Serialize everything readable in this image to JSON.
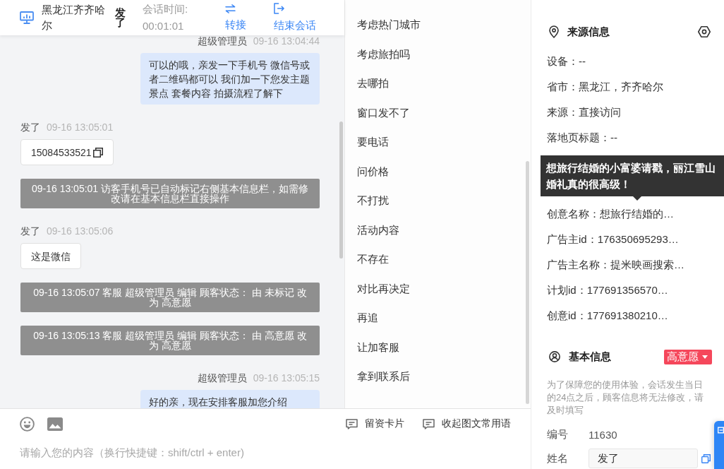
{
  "header": {
    "location": "黑龙江齐齐哈尔",
    "visitor": "发了",
    "duration_label": "会话时间:",
    "duration": "00:01:01",
    "actions": [
      {
        "kind": "transfer",
        "label": "转接"
      },
      {
        "kind": "end",
        "label": "结束会话"
      }
    ]
  },
  "messages": [
    {
      "kind": "agent",
      "sender": "超级管理员",
      "time": "09-16 13:04:44",
      "text": "可以的哦，亲发一下手机号 微信号或者二维码都可以 我们加一下您发主题景点 套餐内容 拍摄流程了解下",
      "copyable": false
    },
    {
      "kind": "visitor",
      "sender": "发了",
      "time": "09-16 13:05:01",
      "text": "15084533521",
      "copyable": true
    },
    {
      "kind": "system",
      "text": "09-16 13:05:01 访客手机号已自动标记右侧基本信息栏，如需修改请在基本信息栏直接操作"
    },
    {
      "kind": "visitor",
      "sender": "发了",
      "time": "09-16 13:05:06",
      "text": "这是微信",
      "copyable": false
    },
    {
      "kind": "system",
      "text": "09-16 13:05:07 客服 超级管理员 编辑 顾客状态： 由 未标记 改为 高意愿"
    },
    {
      "kind": "system",
      "text": "09-16 13:05:13 客服 超级管理员 编辑 顾客状态： 由 高意愿 改为 高意愿"
    },
    {
      "kind": "agent",
      "sender": "超级管理员",
      "time": "09-16 13:05:15",
      "text": "好的亲，现在安排客服加您介绍",
      "copyable": false
    }
  ],
  "quick_replies": [
    "考虑热门城市",
    "考虑旅拍吗",
    "去哪拍",
    "窗口发不了",
    "要电话",
    "问价格",
    "不打扰",
    "活动内容",
    "不存在",
    "对比再决定",
    "再追",
    "让加客服",
    "拿到联系后"
  ],
  "composer": {
    "shortcuts": [
      "留资卡片",
      "收起图文常用语"
    ],
    "placeholder": "请输入您的内容（换行快捷键：shift/ctrl + enter)"
  },
  "source_info": {
    "title": "来源信息",
    "fields": [
      {
        "text": "设备：--"
      },
      {
        "text": "省市：黑龙江，齐齐哈尔"
      },
      {
        "text": "来源：直接访问"
      },
      {
        "text": "落地页标题：--"
      },
      {
        "text": "创意名称：想旅行结婚的…",
        "tooltip": "想旅行结婚的小富婆请戳，丽江雪山婚礼真的很高级！"
      },
      {
        "text": "广告主id：176350695293…"
      },
      {
        "text": "广告主名称：提米映画搜索…"
      },
      {
        "text": "计划id：177691356570…"
      },
      {
        "text": "创意id：177691380210…"
      }
    ]
  },
  "basic_info": {
    "title": "基本信息",
    "intent": "高意愿",
    "note": "为了保障您的使用体验，会话发生当日的24点之后，顾客信息将无法修改，请及时填写",
    "fields": [
      {
        "kind": "text",
        "label": "编号",
        "value": "11630"
      },
      {
        "kind": "input",
        "label": "姓名",
        "value": "发了"
      }
    ]
  }
}
